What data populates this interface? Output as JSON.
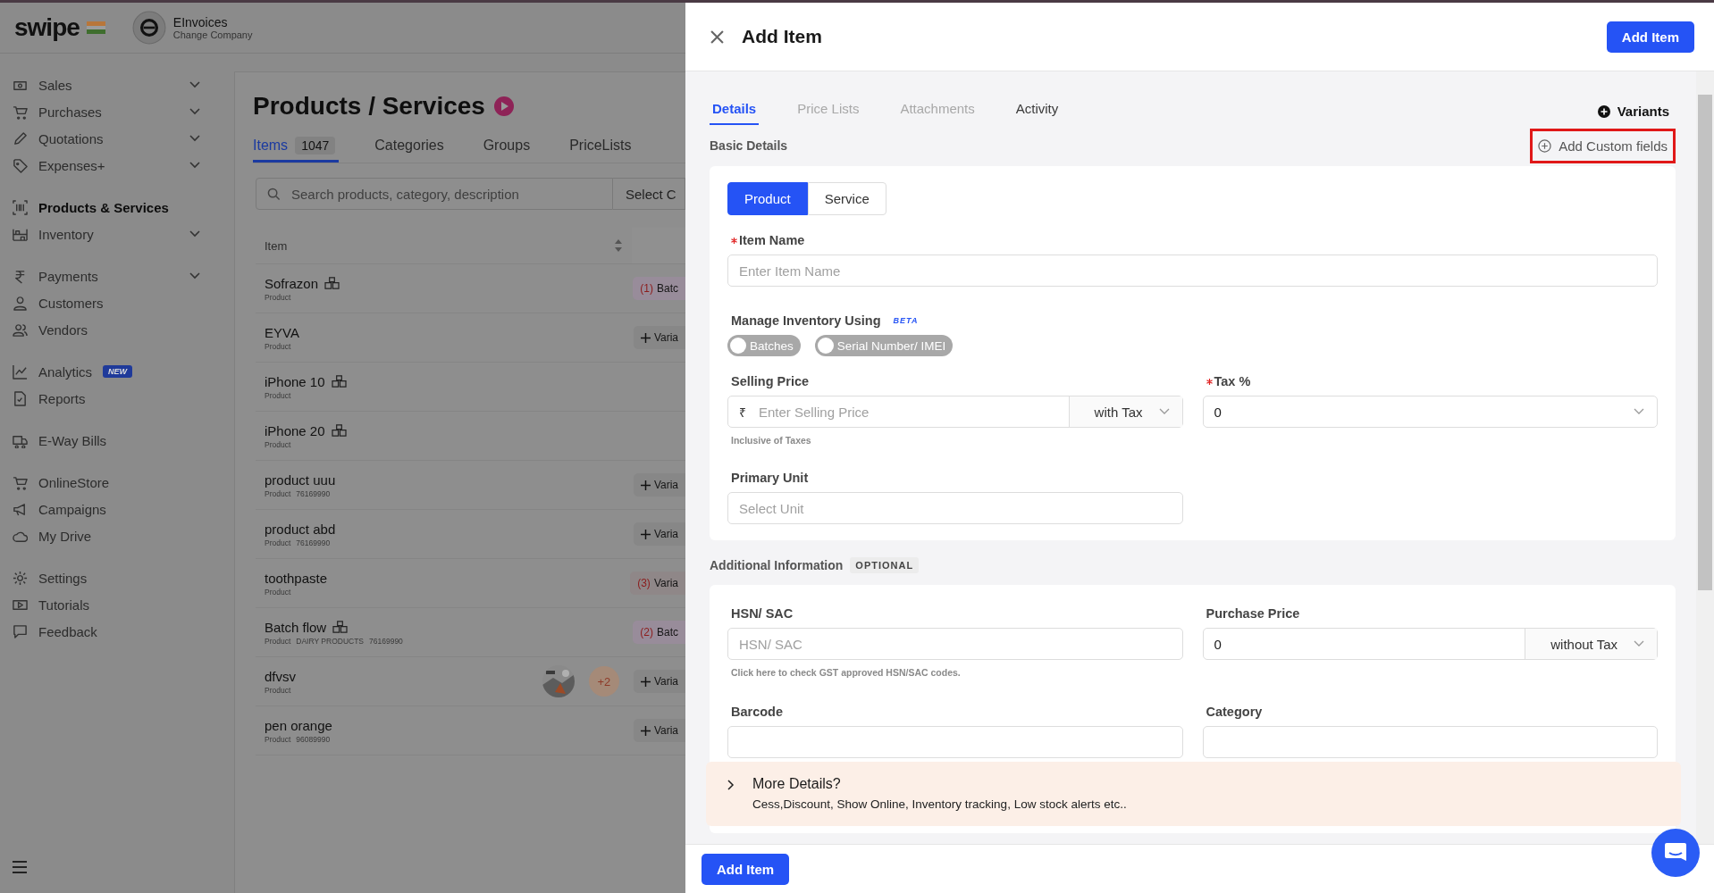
{
  "app": {
    "logo": "swipe",
    "company": {
      "name": "EInvoices",
      "action": "Change Company"
    }
  },
  "sidebar": {
    "sections": [
      {
        "items": [
          {
            "label": "Sales",
            "expandable": true,
            "selected": false
          },
          {
            "label": "Purchases",
            "expandable": true,
            "selected": false
          },
          {
            "label": "Quotations",
            "expandable": true,
            "selected": false
          },
          {
            "label": "Expenses+",
            "expandable": true,
            "selected": false
          }
        ]
      },
      {
        "items": [
          {
            "label": "Products & Services",
            "expandable": false,
            "selected": true
          },
          {
            "label": "Inventory",
            "expandable": true,
            "selected": false
          }
        ]
      },
      {
        "items": [
          {
            "label": "Payments",
            "expandable": true,
            "selected": false
          },
          {
            "label": "Customers",
            "expandable": false,
            "selected": false
          },
          {
            "label": "Vendors",
            "expandable": false,
            "selected": false
          }
        ]
      },
      {
        "items": [
          {
            "label": "Analytics",
            "expandable": false,
            "selected": false,
            "badge": "NEW"
          },
          {
            "label": "Reports",
            "expandable": false,
            "selected": false
          }
        ]
      },
      {
        "items": [
          {
            "label": "E-Way Bills",
            "expandable": false,
            "selected": false
          }
        ]
      },
      {
        "items": [
          {
            "label": "OnlineStore",
            "expandable": false,
            "selected": false
          },
          {
            "label": "Campaigns",
            "expandable": false,
            "selected": false
          },
          {
            "label": "My Drive",
            "expandable": false,
            "selected": false
          }
        ]
      },
      {
        "items": [
          {
            "label": "Settings",
            "expandable": false,
            "selected": false
          },
          {
            "label": "Tutorials",
            "expandable": false,
            "selected": false
          },
          {
            "label": "Feedback",
            "expandable": false,
            "selected": false
          }
        ]
      }
    ]
  },
  "page": {
    "title": "Products / Services",
    "tabs": [
      {
        "label": "Items",
        "count": "1047",
        "selected": true
      },
      {
        "label": "Categories",
        "selected": false
      },
      {
        "label": "Groups",
        "selected": false
      },
      {
        "label": "PriceLists",
        "selected": false
      }
    ],
    "search": {
      "placeholder": "Search products, category, description"
    },
    "filter": "Select C",
    "table": {
      "columns": [
        "Item"
      ],
      "rows": [
        {
          "name": "Sofrazon",
          "meta": [
            "Product"
          ],
          "batched": true,
          "action": {
            "kind": "batch",
            "count": "(1)",
            "label": "Batc"
          }
        },
        {
          "name": "EYVA",
          "meta": [
            "Product"
          ],
          "batched": false,
          "action": {
            "kind": "add",
            "label": "Varia"
          }
        },
        {
          "name": "iPhone 10",
          "meta": [
            "Product"
          ],
          "batched": true
        },
        {
          "name": "iPhone 20",
          "meta": [
            "Product"
          ],
          "batched": true
        },
        {
          "name": "product uuu",
          "meta": [
            "Product",
            "76169990"
          ],
          "batched": false,
          "action": {
            "kind": "add",
            "label": "Varia"
          }
        },
        {
          "name": "product abd",
          "meta": [
            "Product",
            "76169990"
          ],
          "batched": false,
          "action": {
            "kind": "add",
            "label": "Varia"
          }
        },
        {
          "name": "toothpaste",
          "meta": [
            "Product"
          ],
          "batched": false,
          "action": {
            "kind": "variant",
            "count": "(3)",
            "label": "Varia"
          }
        },
        {
          "name": "Batch flow",
          "meta": [
            "Product",
            "DAIRY PRODUCTS",
            "76169990"
          ],
          "batched": true,
          "action": {
            "kind": "batch",
            "count": "(2)",
            "label": "Batc"
          }
        },
        {
          "name": "dfvsv",
          "meta": [
            "Product"
          ],
          "batched": false,
          "images": {
            "kind": "picture",
            "more": "+2"
          },
          "action": {
            "kind": "add",
            "label": "Varia"
          }
        },
        {
          "name": "pen orange",
          "meta": [
            "Product",
            "96089990"
          ],
          "batched": false,
          "action": {
            "kind": "add",
            "label": "Varia"
          }
        }
      ]
    }
  },
  "drawer": {
    "title": "Add Item",
    "primary_button": "Add Item",
    "tabs": [
      {
        "label": "Details",
        "selected": true,
        "disabled": false
      },
      {
        "label": "Price Lists",
        "selected": false,
        "disabled": true
      },
      {
        "label": "Attachments",
        "selected": false,
        "disabled": true
      },
      {
        "label": "Activity",
        "selected": false,
        "disabled": false
      }
    ],
    "variants_button": "Variants",
    "basic": {
      "title": "Basic Details",
      "custom_fields": {
        "label": "Add Custom fields",
        "highlighted": true
      },
      "type_toggle": [
        {
          "label": "Product",
          "selected": true
        },
        {
          "label": "Service",
          "selected": false
        }
      ],
      "item_name": {
        "label": "Item Name",
        "required": true,
        "placeholder": "Enter Item Name"
      },
      "inventory": {
        "label": "Manage Inventory Using",
        "badge": "BETA",
        "switches": [
          {
            "label": "Batches",
            "on": false
          },
          {
            "label": "Serial Number/ IMEI",
            "on": false
          }
        ]
      },
      "selling_price": {
        "label": "Selling Price",
        "currency": "₹",
        "placeholder": "Enter Selling Price",
        "mode": "with Tax",
        "hint": "Inclusive of Taxes"
      },
      "tax": {
        "label": "Tax %",
        "required": true,
        "value": "0"
      },
      "primary_unit": {
        "label": "Primary Unit",
        "placeholder": "Select Unit"
      }
    },
    "additional": {
      "title": "Additional Information",
      "badge": "OPTIONAL",
      "hsn": {
        "label": "HSN/ SAC",
        "placeholder": "HSN/ SAC",
        "hint": "Click here to check GST approved HSN/SAC codes."
      },
      "purchase_price": {
        "label": "Purchase Price",
        "value": "0",
        "mode": "without Tax"
      },
      "barcode": {
        "label": "Barcode"
      },
      "category": {
        "label": "Category"
      }
    },
    "more_details": {
      "title": "More Details?",
      "description": "Cess,Discount, Show Online, Inventory tracking, Low stock alerts etc.."
    },
    "footer_button": "Add Item"
  }
}
